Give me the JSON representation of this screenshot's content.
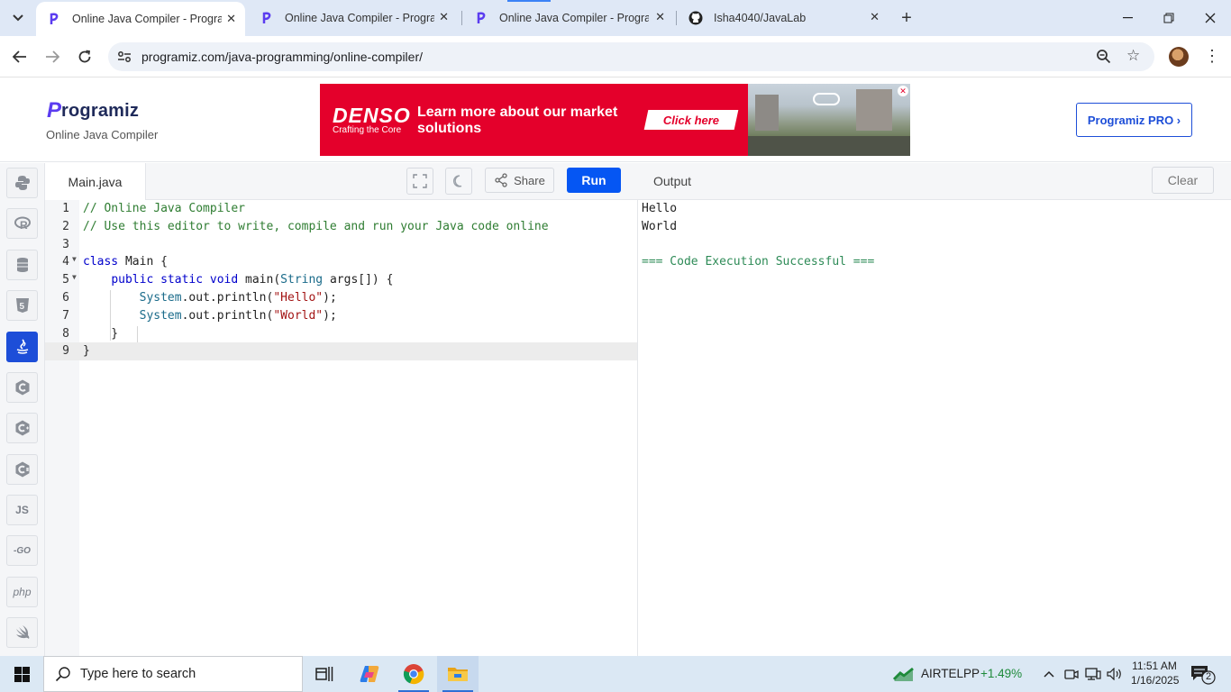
{
  "browser": {
    "tabs": [
      {
        "title": "Online Java Compiler - Programiz",
        "active": true
      },
      {
        "title": "Online Java Compiler - Programiz",
        "active": false
      },
      {
        "title": "Online Java Compiler - Programiz",
        "active": false
      },
      {
        "title": "Isha4040/JavaLab",
        "active": false
      }
    ],
    "url": "programiz.com/java-programming/online-compiler/"
  },
  "header": {
    "logo_text": "rogramiz",
    "logo_mark": "P",
    "subtitle": "Online Java Compiler",
    "pro_button": "Programiz PRO ›"
  },
  "ad": {
    "brand": "DENSO",
    "tagline": "Crafting the Core",
    "message": "Learn more about our market solutions",
    "cta": "Click here"
  },
  "sidebar": {
    "languages": [
      {
        "name": "python",
        "label": "",
        "active": false
      },
      {
        "name": "r",
        "label": "R",
        "active": false
      },
      {
        "name": "sql",
        "label": "",
        "active": false
      },
      {
        "name": "html",
        "label": "5",
        "active": false
      },
      {
        "name": "java",
        "label": "",
        "active": true
      },
      {
        "name": "c",
        "label": "C",
        "active": false
      },
      {
        "name": "cpp",
        "label": "C",
        "active": false
      },
      {
        "name": "csharp",
        "label": "C",
        "active": false
      },
      {
        "name": "javascript",
        "label": "JS",
        "active": false
      },
      {
        "name": "go",
        "label": "-GO",
        "active": false
      },
      {
        "name": "php",
        "label": "php",
        "active": false
      },
      {
        "name": "swift",
        "label": "",
        "active": false
      }
    ]
  },
  "editor": {
    "file_name": "Main.java",
    "share_label": "Share",
    "run_label": "Run",
    "lines": [
      "// Online Java Compiler",
      "// Use this editor to write, compile and run your Java code online",
      "",
      "class Main {",
      "    public static void main(String args[]) {",
      "        System.out.println(\"Hello\");",
      "        System.out.println(\"World\");",
      "    }",
      "}"
    ],
    "line_numbers": [
      "1",
      "2",
      "3",
      "4",
      "5",
      "6",
      "7",
      "8",
      "9"
    ]
  },
  "output": {
    "title": "Output",
    "clear_label": "Clear",
    "lines": [
      "Hello",
      "World",
      "",
      "=== Code Execution Successful ==="
    ]
  },
  "taskbar": {
    "search_placeholder": "Type here to search",
    "stock_name": "AIRTELPP",
    "stock_change": "+1.49%",
    "time": "11:51 AM",
    "date": "1/16/2025",
    "notification_count": "2"
  },
  "colors": {
    "accent": "#0556f3",
    "ad_red": "#e4002b",
    "success": "#2e8b57"
  }
}
